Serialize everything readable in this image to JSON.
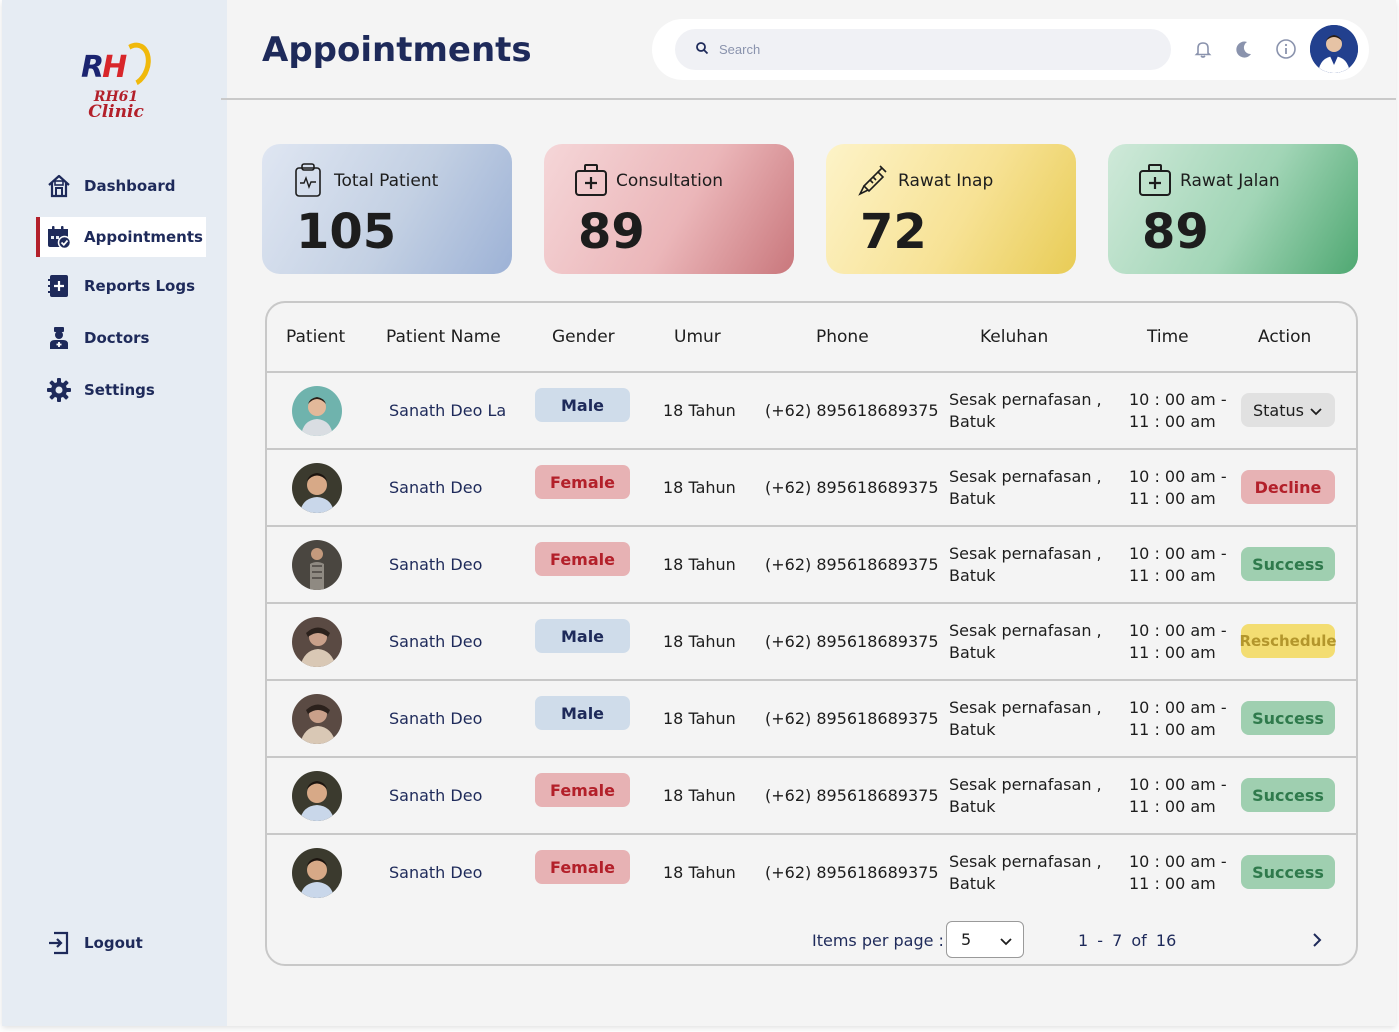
{
  "brand": {
    "initials_r": "R",
    "initials_h": "H",
    "line1": "RH61",
    "line2": "Clinic"
  },
  "sidebar": {
    "items": [
      {
        "label": "Dashboard",
        "icon": "home-icon"
      },
      {
        "label": "Appointments",
        "icon": "calendar-check-icon",
        "active": true
      },
      {
        "label": "Reports Logs",
        "icon": "medical-notebook-icon"
      },
      {
        "label": "Doctors",
        "icon": "doctor-icon"
      },
      {
        "label": "Settings",
        "icon": "gear-icon"
      }
    ],
    "logout": "Logout"
  },
  "header": {
    "title": "Appointments",
    "search_placeholder": "Search"
  },
  "stats": [
    {
      "label": "Total Patient",
      "value": "105",
      "icon": "clipboard-pulse-icon"
    },
    {
      "label": "Consultation",
      "value": "89",
      "icon": "medical-kit-icon"
    },
    {
      "label": "Rawat Inap",
      "value": "72",
      "icon": "syringe-icon"
    },
    {
      "label": "Rawat Jalan",
      "value": "89",
      "icon": "medical-kit-icon"
    }
  ],
  "table": {
    "columns": [
      "Patient",
      "Patient Name",
      "Gender",
      "Umur",
      "Phone",
      "Keluhan",
      "Time",
      "Action"
    ],
    "rows": [
      {
        "name": "Sanath Deo La",
        "gender": "Male",
        "umur": "18 Tahun",
        "phone": "(+62) 895618689375",
        "keluhan1": "Sesak pernafasan ,",
        "keluhan2": "Batuk",
        "time1": "10 : 00 am -",
        "time2": "11 : 00 am",
        "action": "Status"
      },
      {
        "name": "Sanath Deo",
        "gender": "Female",
        "umur": "18 Tahun",
        "phone": "(+62) 895618689375",
        "keluhan1": "Sesak pernafasan ,",
        "keluhan2": "Batuk",
        "time1": "10 : 00 am -",
        "time2": "11 : 00 am",
        "action": "Decline"
      },
      {
        "name": "Sanath Deo",
        "gender": "Female",
        "umur": "18 Tahun",
        "phone": "(+62) 895618689375",
        "keluhan1": "Sesak pernafasan ,",
        "keluhan2": "Batuk",
        "time1": "10 : 00 am -",
        "time2": "11 : 00 am",
        "action": "Success"
      },
      {
        "name": "Sanath Deo",
        "gender": "Male",
        "umur": "18 Tahun",
        "phone": "(+62) 895618689375",
        "keluhan1": "Sesak pernafasan ,",
        "keluhan2": "Batuk",
        "time1": "10 : 00 am -",
        "time2": "11 : 00 am",
        "action": "Reschedule"
      },
      {
        "name": "Sanath Deo",
        "gender": "Male",
        "umur": "18 Tahun",
        "phone": "(+62) 895618689375",
        "keluhan1": "Sesak pernafasan ,",
        "keluhan2": "Batuk",
        "time1": "10 : 00 am -",
        "time2": "11 : 00 am",
        "action": "Success"
      },
      {
        "name": "Sanath Deo",
        "gender": "Female",
        "umur": "18 Tahun",
        "phone": "(+62) 895618689375",
        "keluhan1": "Sesak pernafasan ,",
        "keluhan2": "Batuk",
        "time1": "10 : 00 am -",
        "time2": "11 : 00 am",
        "action": "Success"
      },
      {
        "name": "Sanath Deo",
        "gender": "Female",
        "umur": "18 Tahun",
        "phone": "(+62) 895618689375",
        "keluhan1": "Sesak pernafasan ,",
        "keluhan2": "Batuk",
        "time1": "10 : 00 am -",
        "time2": "11 : 00 am",
        "action": "Success"
      }
    ]
  },
  "pagination": {
    "items_per_page_label": "Items per page :",
    "items_per_page_value": "5",
    "range": "1 - 7 of 16"
  },
  "colors": {
    "navy": "#1e2a5a",
    "accent_red": "#b3202a",
    "success_green": "#9fcfb0",
    "reschedule_yellow": "#f3dd72"
  }
}
